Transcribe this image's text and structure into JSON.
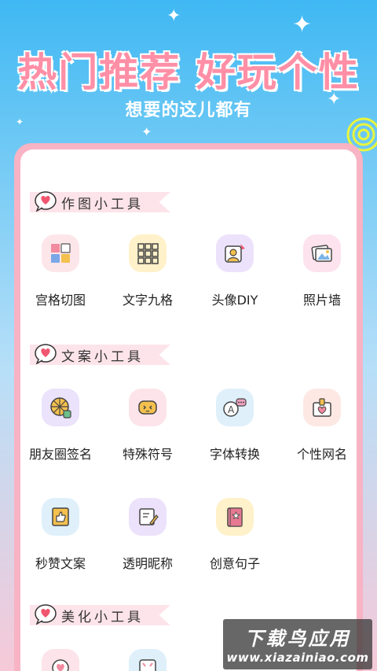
{
  "hero": {
    "title": "热门推荐 好玩个性",
    "subtitle": "想要的这儿都有"
  },
  "sections": [
    {
      "title": "作图小工具",
      "items": [
        {
          "label": "宫格切图",
          "icon": "grid-cut-icon",
          "bg": "#fde6ea"
        },
        {
          "label": "文字九格",
          "icon": "text-grid-icon",
          "bg": "#fff1c9"
        },
        {
          "label": "头像DIY",
          "icon": "avatar-diy-icon",
          "bg": "#ece2fb"
        },
        {
          "label": "照片墙",
          "icon": "photo-wall-icon",
          "bg": "#fde3ee"
        }
      ]
    },
    {
      "title": "文案小工具",
      "items": [
        {
          "label": "朋友圈签名",
          "icon": "moments-signature-icon",
          "bg": "#ebe2fb"
        },
        {
          "label": "特殊符号",
          "icon": "special-symbol-icon",
          "bg": "#fde4ea"
        },
        {
          "label": "字体转换",
          "icon": "font-convert-icon",
          "bg": "#dff0fb"
        },
        {
          "label": "个性网名",
          "icon": "nickname-icon",
          "bg": "#fde8e4"
        },
        {
          "label": "秒赞文案",
          "icon": "like-copy-icon",
          "bg": "#dff0fb"
        },
        {
          "label": "透明昵称",
          "icon": "transparent-name-icon",
          "bg": "#ece2fb"
        },
        {
          "label": "创意句子",
          "icon": "creative-sentence-icon",
          "bg": "#fff1c9"
        }
      ]
    },
    {
      "title": "美化小工具",
      "items": [
        {
          "label": "",
          "icon": "beautify-heart-icon",
          "bg": "#fde4ea"
        },
        {
          "label": "",
          "icon": "beautify-frame-icon",
          "bg": "#dff0fb"
        }
      ]
    }
  ],
  "watermark": {
    "top": "下载鸟应用",
    "bottom": "www.xiazainiao.com"
  },
  "colors": {
    "accent_pink": "#ff8fa6",
    "card_border": "#f8b3c4",
    "heart": "#f0566f"
  }
}
